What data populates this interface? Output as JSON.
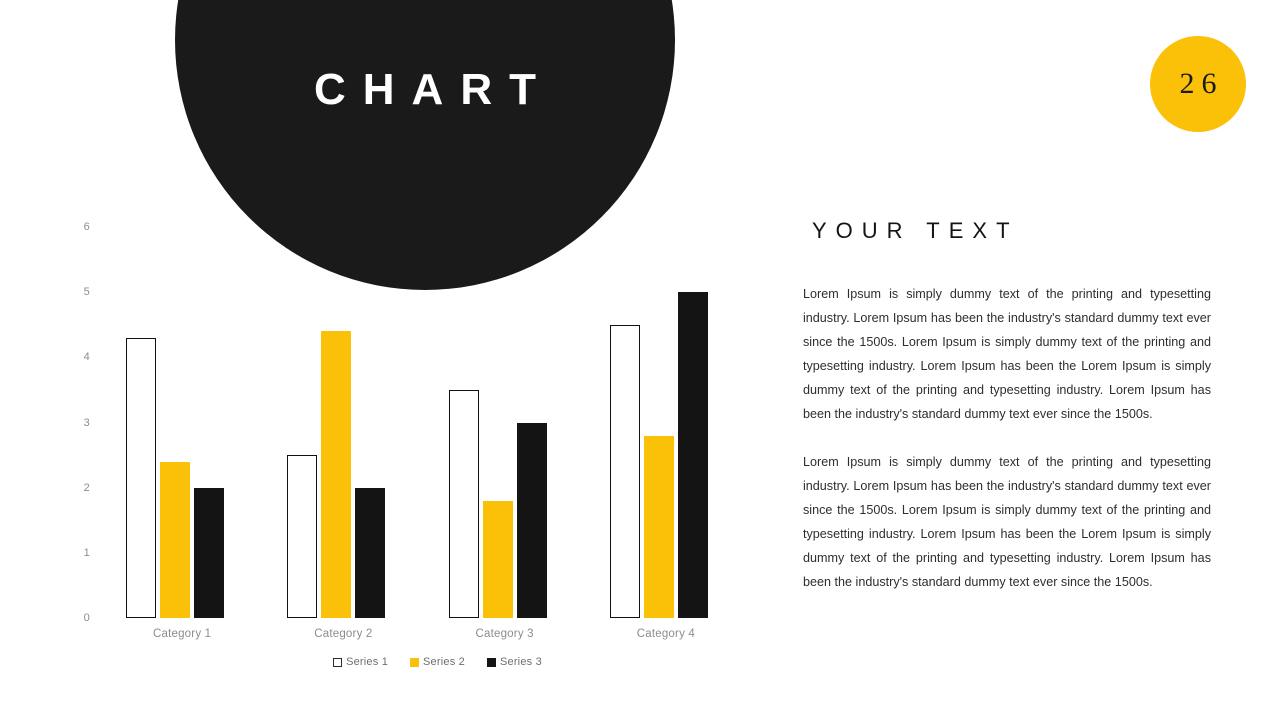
{
  "slide": {
    "title": "CHART",
    "number_badge": "26",
    "accent_color": "#FBC108",
    "dark_color": "#1a1a1a"
  },
  "text_panel": {
    "heading": "YOUR TEXT",
    "paragraphs": [
      "Lorem Ipsum is simply dummy text of the printing and typesetting industry. Lorem Ipsum has been the industry's standard dummy text ever since the 1500s. Lorem Ipsum is simply dummy text of the printing and typesetting industry. Lorem Ipsum has been the Lorem Ipsum is simply dummy text of the printing and typesetting industry. Lorem Ipsum has been the industry's standard dummy text ever since the 1500s.",
      "Lorem Ipsum is simply dummy text of the printing and typesetting industry. Lorem Ipsum has been the industry's standard dummy text ever since the 1500s. Lorem Ipsum is simply dummy text of the printing and typesetting industry. Lorem Ipsum has been the Lorem Ipsum is simply dummy text of the printing and typesetting industry. Lorem Ipsum has been the industry's standard dummy text ever since the 1500s."
    ]
  },
  "chart_data": {
    "type": "bar",
    "title": "CHART",
    "xlabel": "",
    "ylabel": "",
    "ylim": [
      0,
      6
    ],
    "yticks": [
      0,
      1,
      2,
      3,
      4,
      5,
      6
    ],
    "ytick_labels": [
      "0",
      "1",
      "2",
      "3",
      "4",
      "5",
      "6"
    ],
    "grid": false,
    "legend_position": "bottom-center",
    "categories": [
      "Category 1",
      "Category 2",
      "Category 3",
      "Category 4"
    ],
    "series": [
      {
        "name": "Series 1",
        "color": "#ffffff",
        "values": [
          4.3,
          2.5,
          3.5,
          4.5
        ]
      },
      {
        "name": "Series 2",
        "color": "#FBC108",
        "values": [
          2.4,
          4.4,
          1.8,
          2.8
        ]
      },
      {
        "name": "Series 3",
        "color": "#141414",
        "values": [
          2.0,
          2.0,
          3.0,
          5.0
        ]
      }
    ]
  }
}
